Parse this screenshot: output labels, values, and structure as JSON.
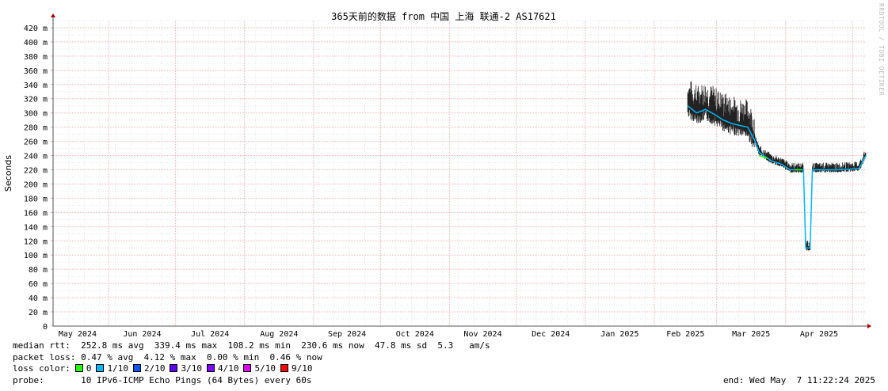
{
  "chart_data": {
    "type": "line",
    "title": "365天前的数据 from 中国 上海 联通-2 AS17621",
    "ylabel": "Seconds",
    "ylim_ms": [
      0,
      430
    ],
    "y_ticks": [
      "0",
      "20 m",
      "40 m",
      "60 m",
      "80 m",
      "100 m",
      "120 m",
      "140 m",
      "160 m",
      "180 m",
      "200 m",
      "220 m",
      "240 m",
      "260 m",
      "280 m",
      "300 m",
      "320 m",
      "340 m",
      "360 m",
      "380 m",
      "400 m",
      "420 m"
    ],
    "x_ticks": [
      "May 2024",
      "Jun 2024",
      "Jul 2024",
      "Aug 2024",
      "Sep 2024",
      "Oct 2024",
      "Nov 2024",
      "Dec 2024",
      "Jan 2025",
      "Feb 2025",
      "Mar 2025",
      "Apr 2025"
    ],
    "x_range": [
      "2024-05-07",
      "2025-05-07"
    ],
    "grid": true,
    "series": [
      {
        "name": "median rtt",
        "points": [
          [
            "2025-02-16",
            310
          ],
          [
            "2025-02-20",
            300
          ],
          [
            "2025-02-24",
            305
          ],
          [
            "2025-02-28",
            298
          ],
          [
            "2025-03-04",
            290
          ],
          [
            "2025-03-08",
            285
          ],
          [
            "2025-03-12",
            282
          ],
          [
            "2025-03-15",
            280
          ],
          [
            "2025-03-18",
            262
          ],
          [
            "2025-03-20",
            245
          ],
          [
            "2025-03-23",
            238
          ],
          [
            "2025-03-26",
            232
          ],
          [
            "2025-03-30",
            228
          ],
          [
            "2025-04-03",
            220
          ],
          [
            "2025-04-06",
            220
          ],
          [
            "2025-04-09",
            220
          ],
          [
            "2025-04-10",
            110
          ],
          [
            "2025-04-12",
            110
          ],
          [
            "2025-04-13",
            220
          ],
          [
            "2025-04-18",
            220
          ],
          [
            "2025-04-24",
            220
          ],
          [
            "2025-04-30",
            221
          ],
          [
            "2025-05-04",
            222
          ],
          [
            "2025-05-07",
            240
          ]
        ]
      }
    ]
  },
  "side_label": "RRDTOOL / TOBI OETIKER",
  "stats": {
    "median_line": "median rtt:  252.8 ms avg  339.4 ms max  108.2 ms min  230.6 ms now  47.8 ms sd  5.3   am/s",
    "loss_line": "packet loss: 0.47 % avg  4.12 % max  0.00 % min  0.46 % now",
    "loss_color_label": "loss color:",
    "loss_colors": [
      {
        "label": "0",
        "color": "#26ff00"
      },
      {
        "label": "1/10",
        "color": "#00b8ff"
      },
      {
        "label": "2/10",
        "color": "#0059ff"
      },
      {
        "label": "3/10",
        "color": "#5e00ff"
      },
      {
        "label": "4/10",
        "color": "#7e00ff"
      },
      {
        "label": "5/10",
        "color": "#dd00ff"
      },
      {
        "label": "9/10",
        "color": "#ff0000"
      }
    ],
    "probe_line": "probe:       10 IPv6-ICMP Echo Pings (64 Bytes) every 60s",
    "end_line": "end: Wed May  7 11:22:24 2025"
  }
}
